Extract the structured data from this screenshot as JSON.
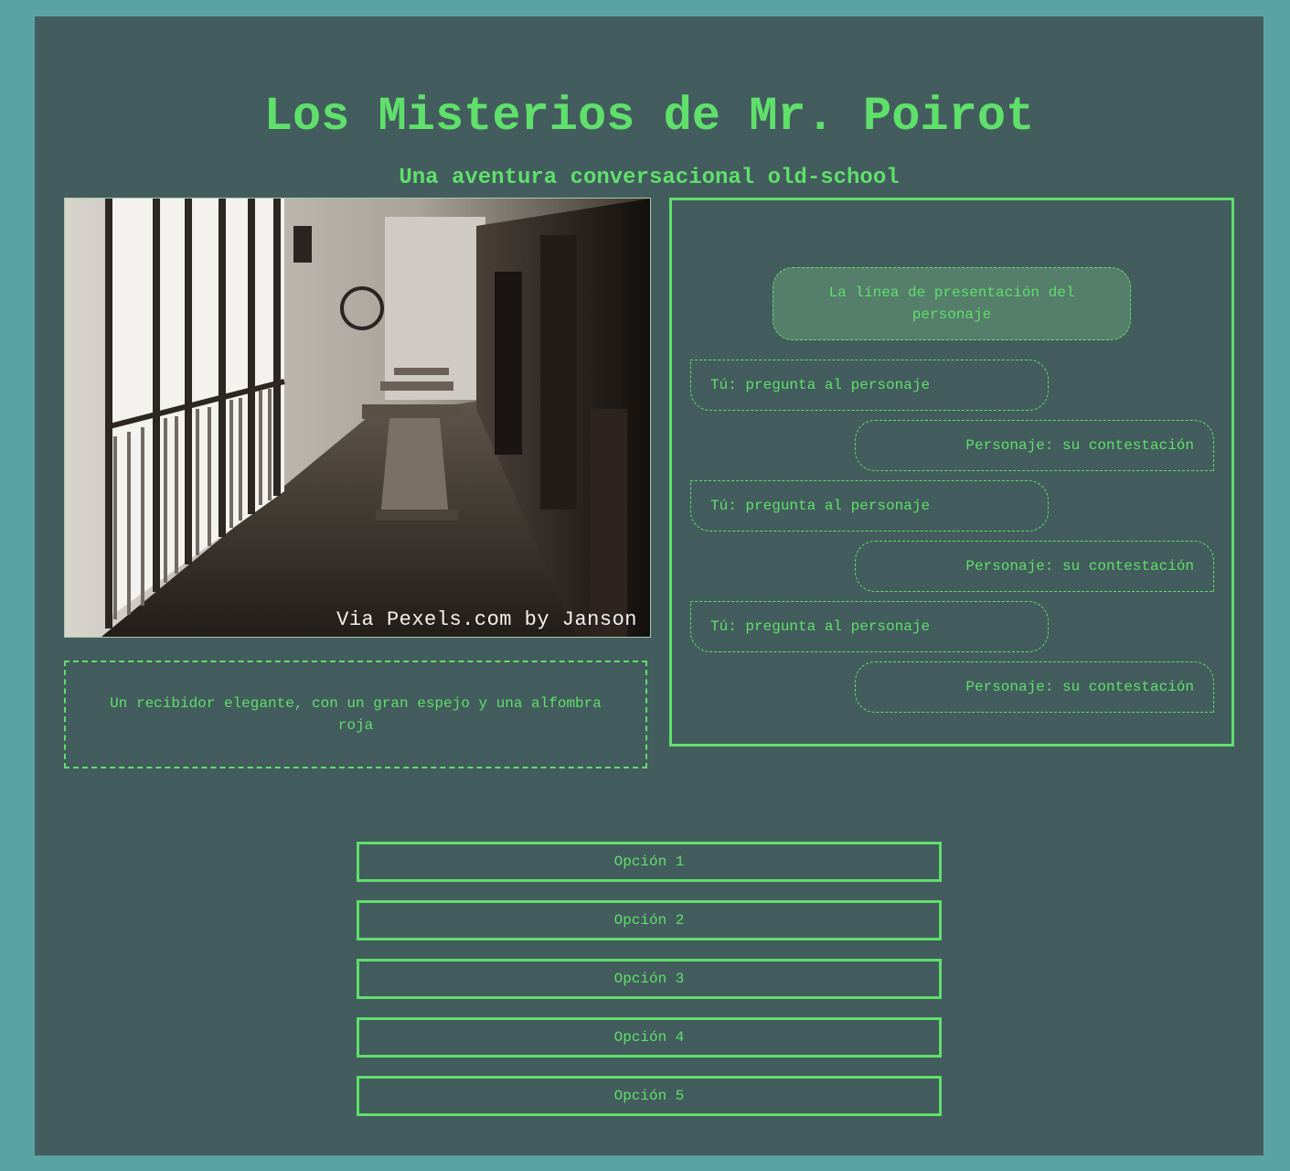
{
  "header": {
    "title": "Los Misterios de Mr. Poirot",
    "subtitle": "Una aventura conversacional old-school"
  },
  "scene": {
    "photo_credit": "Via Pexels.com by Janson",
    "description": "Un recibidor elegante, con un gran espejo y una alfombra roja"
  },
  "chat": {
    "intro": "La línea de presentación del personaje",
    "messages": [
      {
        "speaker": "user",
        "text": "Tú: pregunta al personaje"
      },
      {
        "speaker": "character",
        "text": "Personaje: su contestación"
      },
      {
        "speaker": "user",
        "text": "Tú: pregunta al personaje"
      },
      {
        "speaker": "character",
        "text": "Personaje: su contestación"
      },
      {
        "speaker": "user",
        "text": "Tú: pregunta al personaje"
      },
      {
        "speaker": "character",
        "text": "Personaje: su contestación"
      }
    ]
  },
  "options": [
    "Opción 1",
    "Opción 2",
    "Opción 3",
    "Opción 4",
    "Opción 5"
  ],
  "colors": {
    "background": "#5aa3a5",
    "panel": "#435c5d",
    "accent": "#5fe06b",
    "intro_bubble": "#557e6b"
  }
}
